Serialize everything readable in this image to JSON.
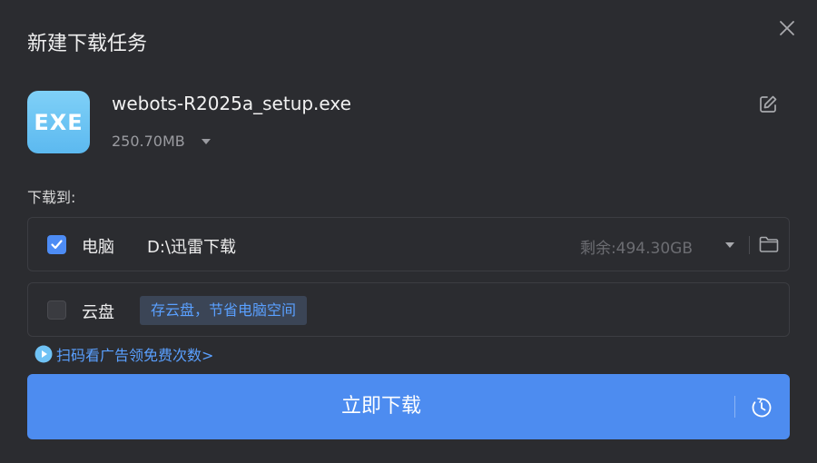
{
  "dialog": {
    "title": "新建下载任务"
  },
  "file": {
    "icon_text": "EXE",
    "name": "webots-R2025a_setup.exe",
    "size": "250.70MB"
  },
  "destination": {
    "label": "下载到:",
    "pc": {
      "checked": true,
      "label": "电脑",
      "path": "D:\\迅雷下载",
      "free_space": "剩余:494.30GB"
    },
    "cloud": {
      "checked": false,
      "label": "云盘",
      "tip": "存云盘，节省电脑空间"
    }
  },
  "promo": {
    "text": "扫码看广告领免费次数>"
  },
  "download_button": {
    "label": "立即下载"
  },
  "colors": {
    "background": "#2b2c30",
    "accent": "#4d8cf0",
    "link": "#5aa0ff",
    "muted": "#6c6d72"
  },
  "icons": [
    "close-icon",
    "edit-icon",
    "chevron-down-icon",
    "folder-icon",
    "check-icon",
    "play-icon",
    "clock-icon"
  ]
}
